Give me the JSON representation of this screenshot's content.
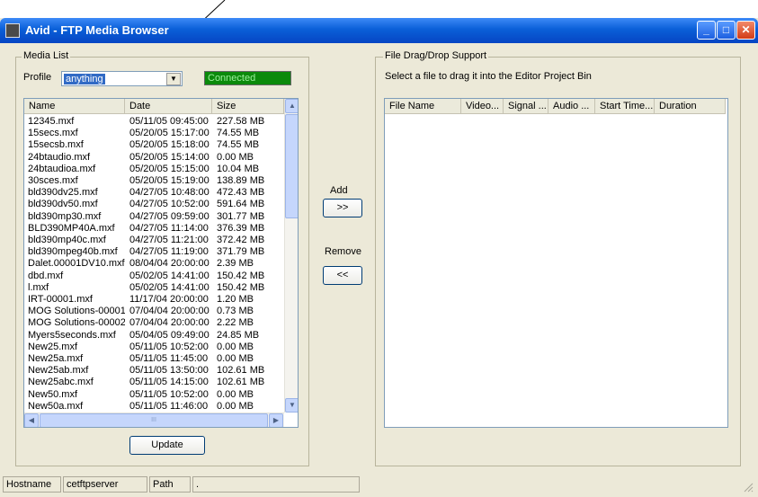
{
  "window": {
    "title": "Avid - FTP Media Browser"
  },
  "media_list": {
    "group_label": "Media List",
    "profile_label": "Profile",
    "profile_value": "anything",
    "status": "Connected",
    "columns": [
      "Name",
      "Date",
      "Size"
    ],
    "rows": [
      {
        "name": "12345.mxf",
        "date": "05/11/05 09:45:00",
        "size": "227.58 MB"
      },
      {
        "name": "15secs.mxf",
        "date": "05/20/05 15:17:00",
        "size": "74.55 MB"
      },
      {
        "name": "15secsb.mxf",
        "date": "05/20/05 15:18:00",
        "size": "74.55 MB"
      },
      {
        "name": "24btaudio.mxf",
        "date": "05/20/05 15:14:00",
        "size": "0.00 MB"
      },
      {
        "name": "24btaudioa.mxf",
        "date": "05/20/05 15:15:00",
        "size": "10.04 MB"
      },
      {
        "name": "30sces.mxf",
        "date": "05/20/05 15:19:00",
        "size": "138.89 MB"
      },
      {
        "name": "bld390dv25.mxf",
        "date": "04/27/05 10:48:00",
        "size": "472.43 MB"
      },
      {
        "name": "bld390dv50.mxf",
        "date": "04/27/05 10:52:00",
        "size": "591.64 MB"
      },
      {
        "name": "bld390mp30.mxf",
        "date": "04/27/05 09:59:00",
        "size": "301.77 MB"
      },
      {
        "name": "BLD390MP40A.mxf",
        "date": "04/27/05 11:14:00",
        "size": "376.39 MB"
      },
      {
        "name": "bld390mp40c.mxf",
        "date": "04/27/05 11:21:00",
        "size": "372.42 MB"
      },
      {
        "name": "bld390mpeg40b.mxf",
        "date": "04/27/05 11:19:00",
        "size": "371.79 MB"
      },
      {
        "name": "Dalet.00001DV10.mxf",
        "date": "08/04/04 20:00:00",
        "size": "2.39 MB"
      },
      {
        "name": "dbd.mxf",
        "date": "05/02/05 14:41:00",
        "size": "150.42 MB"
      },
      {
        "name": "l.mxf",
        "date": "05/02/05 14:41:00",
        "size": "150.42 MB"
      },
      {
        "name": "IRT-00001.mxf",
        "date": "11/17/04 20:00:00",
        "size": "1.20 MB"
      },
      {
        "name": "MOG Solutions-00001...",
        "date": "07/04/04 20:00:00",
        "size": "0.73 MB"
      },
      {
        "name": "MOG Solutions-00002...",
        "date": "07/04/04 20:00:00",
        "size": "2.22 MB"
      },
      {
        "name": "Myers5seconds.mxf",
        "date": "05/04/05 09:49:00",
        "size": "24.85 MB"
      },
      {
        "name": "New25.mxf",
        "date": "05/11/05 10:52:00",
        "size": "0.00 MB"
      },
      {
        "name": "New25a.mxf",
        "date": "05/11/05 11:45:00",
        "size": "0.00 MB"
      },
      {
        "name": "New25ab.mxf",
        "date": "05/11/05 13:50:00",
        "size": "102.61 MB"
      },
      {
        "name": "New25abc.mxf",
        "date": "05/11/05 14:15:00",
        "size": "102.61 MB"
      },
      {
        "name": "New50.mxf",
        "date": "05/11/05 10:52:00",
        "size": "0.00 MB"
      },
      {
        "name": "New50a.mxf",
        "date": "05/11/05 11:46:00",
        "size": "0.00 MB"
      }
    ],
    "update_label": "Update",
    "hscroll_grip": "III"
  },
  "transfer": {
    "add_label": "Add",
    "add_button": ">>",
    "remove_label": "Remove",
    "remove_button": "<<"
  },
  "drag_drop": {
    "group_label": "File Drag/Drop Support",
    "instruction": "Select a file to drag it into the Editor Project Bin",
    "columns": [
      "File Name",
      "Video...",
      "Signal ...",
      "Audio ...",
      "Start Time...",
      "Duration"
    ]
  },
  "statusbar": {
    "hostname_label": "Hostname",
    "hostname_value": "cetftpserver",
    "path_label": "Path",
    "path_value": "."
  }
}
